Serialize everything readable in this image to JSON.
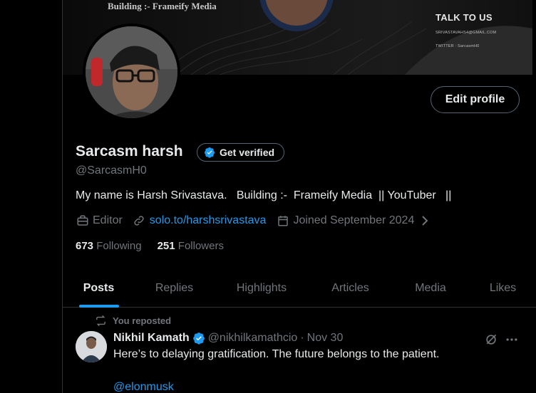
{
  "banner": {
    "tagline": "Building :- Frameify Media",
    "talk_title": "TALK TO US",
    "email": "SRIVASTAVAHS4@GMAIL.COM",
    "twitter": "TWITTER : SarcasmH0"
  },
  "profile": {
    "edit_label": "Edit profile",
    "name": "Sarcasm harsh",
    "get_verified_label": "Get verified",
    "handle": "@SarcasmH0",
    "bio": "My name is Harsh Srivastava.   Building :-  Frameify Media  || YouTuber   ||",
    "occupation": "Editor",
    "link": "solo.to/harshsrivastava",
    "joined": "Joined September 2024",
    "following_count": "673",
    "following_label": "Following",
    "followers_count": "251",
    "followers_label": "Followers"
  },
  "tabs": [
    {
      "label": "Posts",
      "active": true
    },
    {
      "label": "Replies",
      "active": false
    },
    {
      "label": "Highlights",
      "active": false
    },
    {
      "label": "Articles",
      "active": false
    },
    {
      "label": "Media",
      "active": false
    },
    {
      "label": "Likes",
      "active": false
    }
  ],
  "tweet": {
    "repost_label": "You reposted",
    "author_name": "Nikhil Kamath",
    "author_handle": "@nikhilkamathcio",
    "separator": "·",
    "date": "Nov 30",
    "text": "Here’s to delaying gratification. The future belongs to the patient.",
    "mention": "@elonmusk"
  },
  "colors": {
    "accent": "#1d9bf0",
    "background": "#000000",
    "text_primary": "#e7e9ea",
    "text_secondary": "#71767b",
    "border": "#2f3336"
  },
  "icons": [
    "briefcase-icon",
    "link-icon",
    "calendar-icon",
    "chevron-right-icon",
    "verified-badge-icon",
    "repost-icon",
    "grok-icon",
    "more-icon"
  ]
}
